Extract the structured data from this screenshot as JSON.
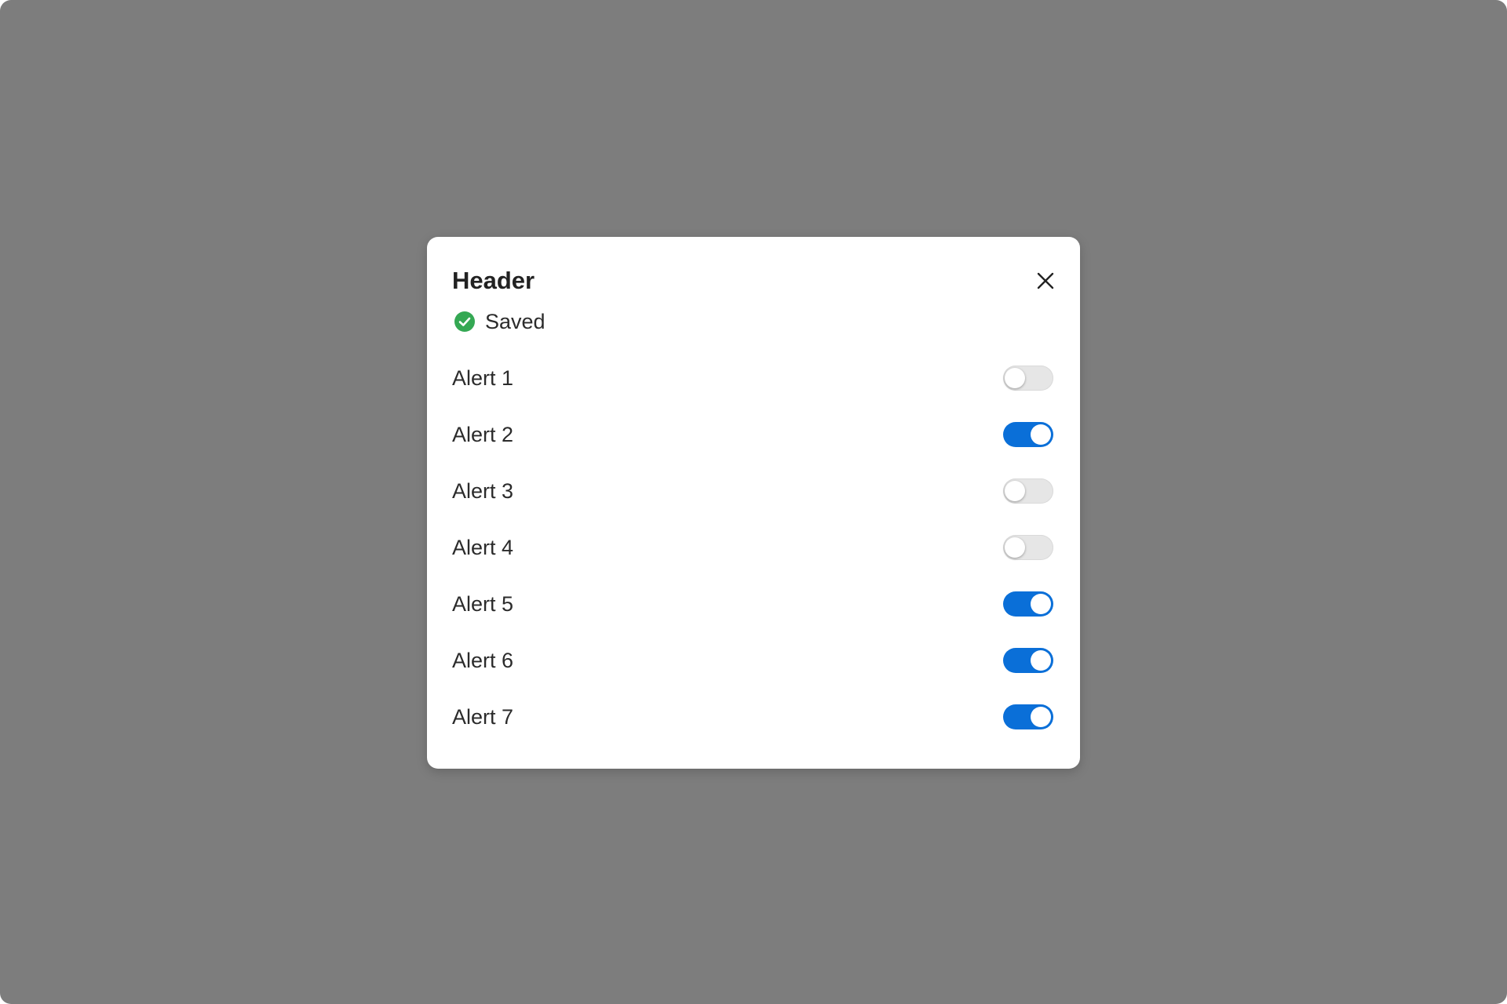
{
  "modal": {
    "title": "Header",
    "status": {
      "text": "Saved",
      "icon": "check-circle-icon",
      "color": "#34a853"
    },
    "close_icon": "close-icon"
  },
  "alerts": [
    {
      "label": "Alert 1",
      "enabled": false
    },
    {
      "label": "Alert 2",
      "enabled": true
    },
    {
      "label": "Alert 3",
      "enabled": false
    },
    {
      "label": "Alert 4",
      "enabled": false
    },
    {
      "label": "Alert 5",
      "enabled": true
    },
    {
      "label": "Alert 6",
      "enabled": true
    },
    {
      "label": "Alert 7",
      "enabled": true
    }
  ],
  "colors": {
    "overlay": "#7d7d7d",
    "toggle_on": "#0a6fd8",
    "toggle_off": "#e6e6e6"
  }
}
